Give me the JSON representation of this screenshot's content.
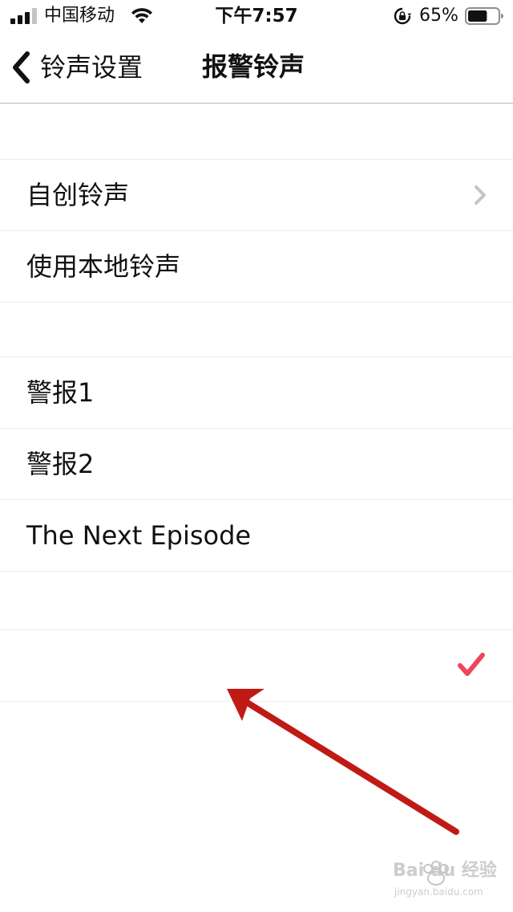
{
  "status_bar": {
    "carrier": "中国移动",
    "time": "下午7:57",
    "battery_percent": "65%",
    "battery_level": 0.65,
    "icons": [
      "signal-icon",
      "wifi-icon",
      "rotation-lock-icon",
      "battery-icon"
    ]
  },
  "nav": {
    "back_label": "铃声设置",
    "title": "报警铃声"
  },
  "sections": {
    "custom": {
      "items": [
        {
          "label": "自创铃声",
          "accessory": "chevron-right-icon"
        },
        {
          "label": "使用本地铃声"
        }
      ]
    },
    "builtin": {
      "items": [
        {
          "label": "警报1"
        },
        {
          "label": "警报2"
        },
        {
          "label": "The Next Episode"
        }
      ]
    },
    "selected": {
      "items": [
        {
          "label": "",
          "accessory": "checkmark-icon"
        }
      ]
    }
  },
  "colors": {
    "checkmark": "#f0455a",
    "annotation_arrow": "#c01a14",
    "separator": "#ececec"
  },
  "watermark": {
    "text": "Bai du 经验",
    "sub": "jingyan.baidu.com"
  }
}
